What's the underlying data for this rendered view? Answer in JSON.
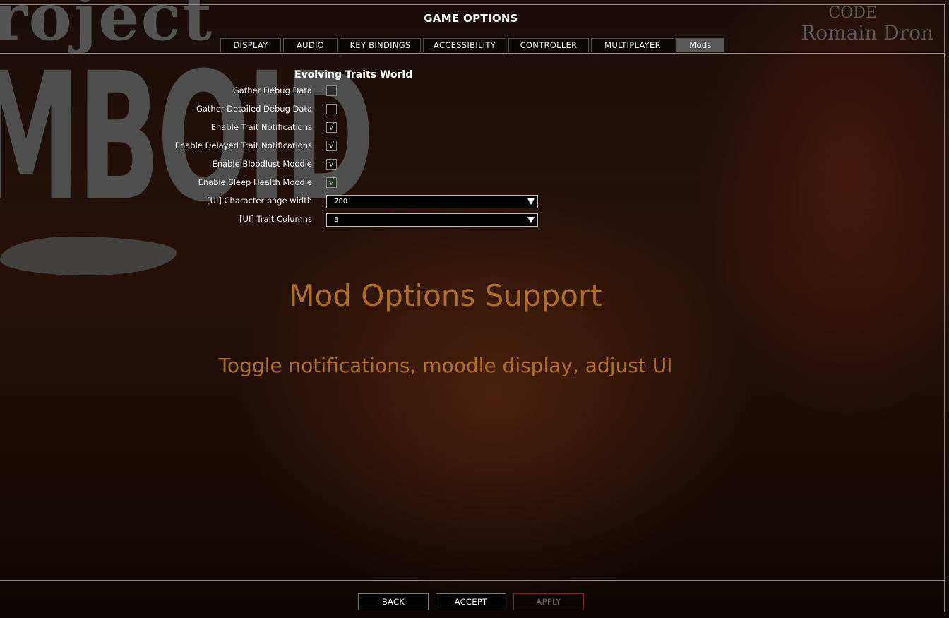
{
  "window": {
    "title": "GAME OPTIONS"
  },
  "background": {
    "logo_top": "roject",
    "logo_big": "MBOID",
    "credit_label": "CODE",
    "credit_name": "Romain Dron"
  },
  "tabs": [
    {
      "label": "DISPLAY"
    },
    {
      "label": "AUDIO"
    },
    {
      "label": "KEY BINDINGS"
    },
    {
      "label": "ACCESSIBILITY"
    },
    {
      "label": "CONTROLLER"
    },
    {
      "label": "MULTIPLAYER"
    },
    {
      "label": "Mods",
      "active": true
    }
  ],
  "mod": {
    "title": "Evolving Traits World",
    "options": [
      {
        "label": "Gather Debug Data",
        "type": "checkbox",
        "checked": false
      },
      {
        "label": "Gather Detailed Debug Data",
        "type": "checkbox",
        "checked": false
      },
      {
        "label": "Enable Trait Notifications",
        "type": "checkbox",
        "checked": true
      },
      {
        "label": "Enable Delayed Trait Notifications",
        "type": "checkbox",
        "checked": true
      },
      {
        "label": "Enable Bloodlust Moodle",
        "type": "checkbox",
        "checked": true
      },
      {
        "label": "Enable Sleep Health Moodle",
        "type": "checkbox",
        "checked": true
      },
      {
        "label": "[UI] Character page width",
        "type": "combo",
        "value": "700"
      },
      {
        "label": "[UI] Trait Columns",
        "type": "combo",
        "value": "3"
      }
    ],
    "check_glyph": "√"
  },
  "overlay": {
    "headline": "Mod Options Support",
    "subline": "Toggle notifications, moodle display, adjust UI",
    "color": "#b06f22"
  },
  "footer": {
    "back": "BACK",
    "accept": "ACCEPT",
    "apply": "APPLY"
  }
}
